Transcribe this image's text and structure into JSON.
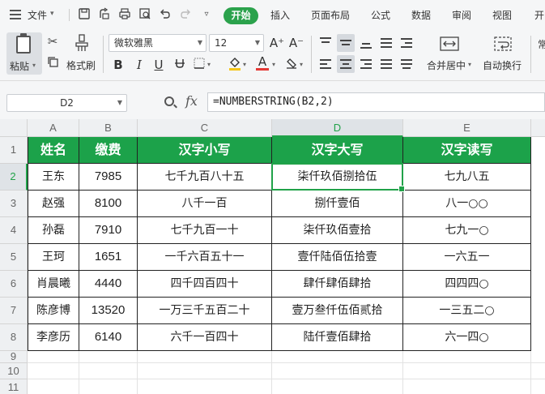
{
  "menu": {
    "file_label": "文件",
    "tabs": [
      "开始",
      "插入",
      "页面布局",
      "公式",
      "数据",
      "审阅",
      "视图",
      "开"
    ],
    "active_tab": "开始"
  },
  "ribbon": {
    "paste_label": "粘贴",
    "format_painter_label": "格式刷",
    "font_name": "微软雅黑",
    "font_size": "12",
    "merge_label": "合并居中",
    "wrap_label": "自动换行",
    "bold": "B",
    "italic": "I",
    "underline": "U",
    "grow_font": "A⁺",
    "shrink_font": "A⁻",
    "font_color_letter": "A",
    "font_color": "#e53935",
    "fill_color": "#f5c518",
    "truncated_label": "常"
  },
  "formula_bar": {
    "name_box": "D2",
    "fx": "fx",
    "formula": "=NUMBERSTRING(B2,2)"
  },
  "sheet": {
    "columns": [
      "A",
      "B",
      "C",
      "D",
      "E"
    ],
    "selected_column": "D",
    "selected_row": "2",
    "row_numbers": [
      "1",
      "2",
      "3",
      "4",
      "5",
      "6",
      "7",
      "8",
      "9",
      "10",
      "11"
    ],
    "header": [
      "姓名",
      "缴费",
      "汉字小写",
      "汉字大写",
      "汉字读写"
    ],
    "rows": [
      [
        "王东",
        "7985",
        "七千九百八十五",
        "柒仟玖佰捌拾伍",
        "七九八五"
      ],
      [
        "赵强",
        "8100",
        "八千一百",
        "捌仟壹佰",
        "八一○○"
      ],
      [
        "孙磊",
        "7910",
        "七千九百一十",
        "柒仟玖佰壹拾",
        "七九一○"
      ],
      [
        "王珂",
        "1651",
        "一千六百五十一",
        "壹仟陆佰伍拾壹",
        "一六五一"
      ],
      [
        "肖晨曦",
        "4440",
        "四千四百四十",
        "肆仟肆佰肆拾",
        "四四四○"
      ],
      [
        "陈彦博",
        "13520",
        "一万三千五百二十",
        "壹万叁仟伍佰贰拾",
        "一三五二○"
      ],
      [
        "李彦历",
        "6140",
        "六千一百四十",
        "陆仟壹佰肆拾",
        "六一四○"
      ]
    ],
    "header_color": "#1ca24a",
    "selection_color": "#21a249"
  }
}
